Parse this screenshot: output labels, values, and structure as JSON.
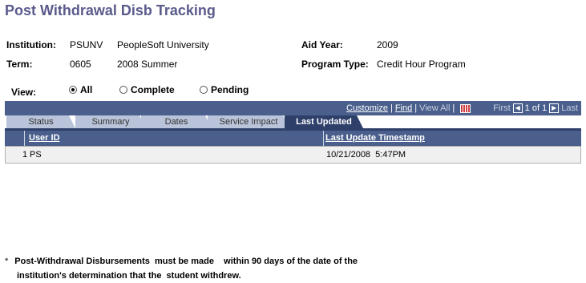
{
  "page": {
    "title": "Post Withdrawal Disb Tracking"
  },
  "info": {
    "institution_label": "Institution:",
    "institution_code": "PSUNV",
    "institution_name": "PeopleSoft University",
    "term_label": "Term:",
    "term_code": "0605",
    "term_name": "2008 Summer",
    "aid_year_label": "Aid Year:",
    "aid_year_value": "2009",
    "program_type_label": "Program Type:",
    "program_type_value": "Credit Hour Program"
  },
  "view": {
    "label": "View:",
    "options": [
      {
        "label": "All",
        "selected": true
      },
      {
        "label": "Complete",
        "selected": false
      },
      {
        "label": "Pending",
        "selected": false
      }
    ]
  },
  "grid_nav": {
    "customize": "Customize",
    "find": "Find",
    "view_all": "View All",
    "first": "First",
    "range": "1 of 1",
    "last": "Last",
    "sep": "|"
  },
  "tabs": [
    {
      "label": "Status",
      "active": false
    },
    {
      "label": "Summary",
      "active": false
    },
    {
      "label": "Dates",
      "active": false
    },
    {
      "label": "Service Impact",
      "active": false
    },
    {
      "label": "Last Updated",
      "active": true
    }
  ],
  "table": {
    "columns": [
      "User ID",
      "Last Update Timestamp"
    ],
    "rows": [
      {
        "num": "1",
        "user_id": "PS",
        "timestamp": "10/21/2008  5:47PM"
      }
    ]
  },
  "footnote": {
    "star": "*",
    "line1": "Post-Withdrawal Disbursements  must be made    within 90 days of the date of the",
    "line2": "institution's determination that the  student withdrew."
  },
  "colors": {
    "header_bg": "#4a5f8c",
    "tab_active": "#2e3f6a",
    "tab_inactive": "#b9c3d9",
    "title": "#5a5a8c"
  }
}
